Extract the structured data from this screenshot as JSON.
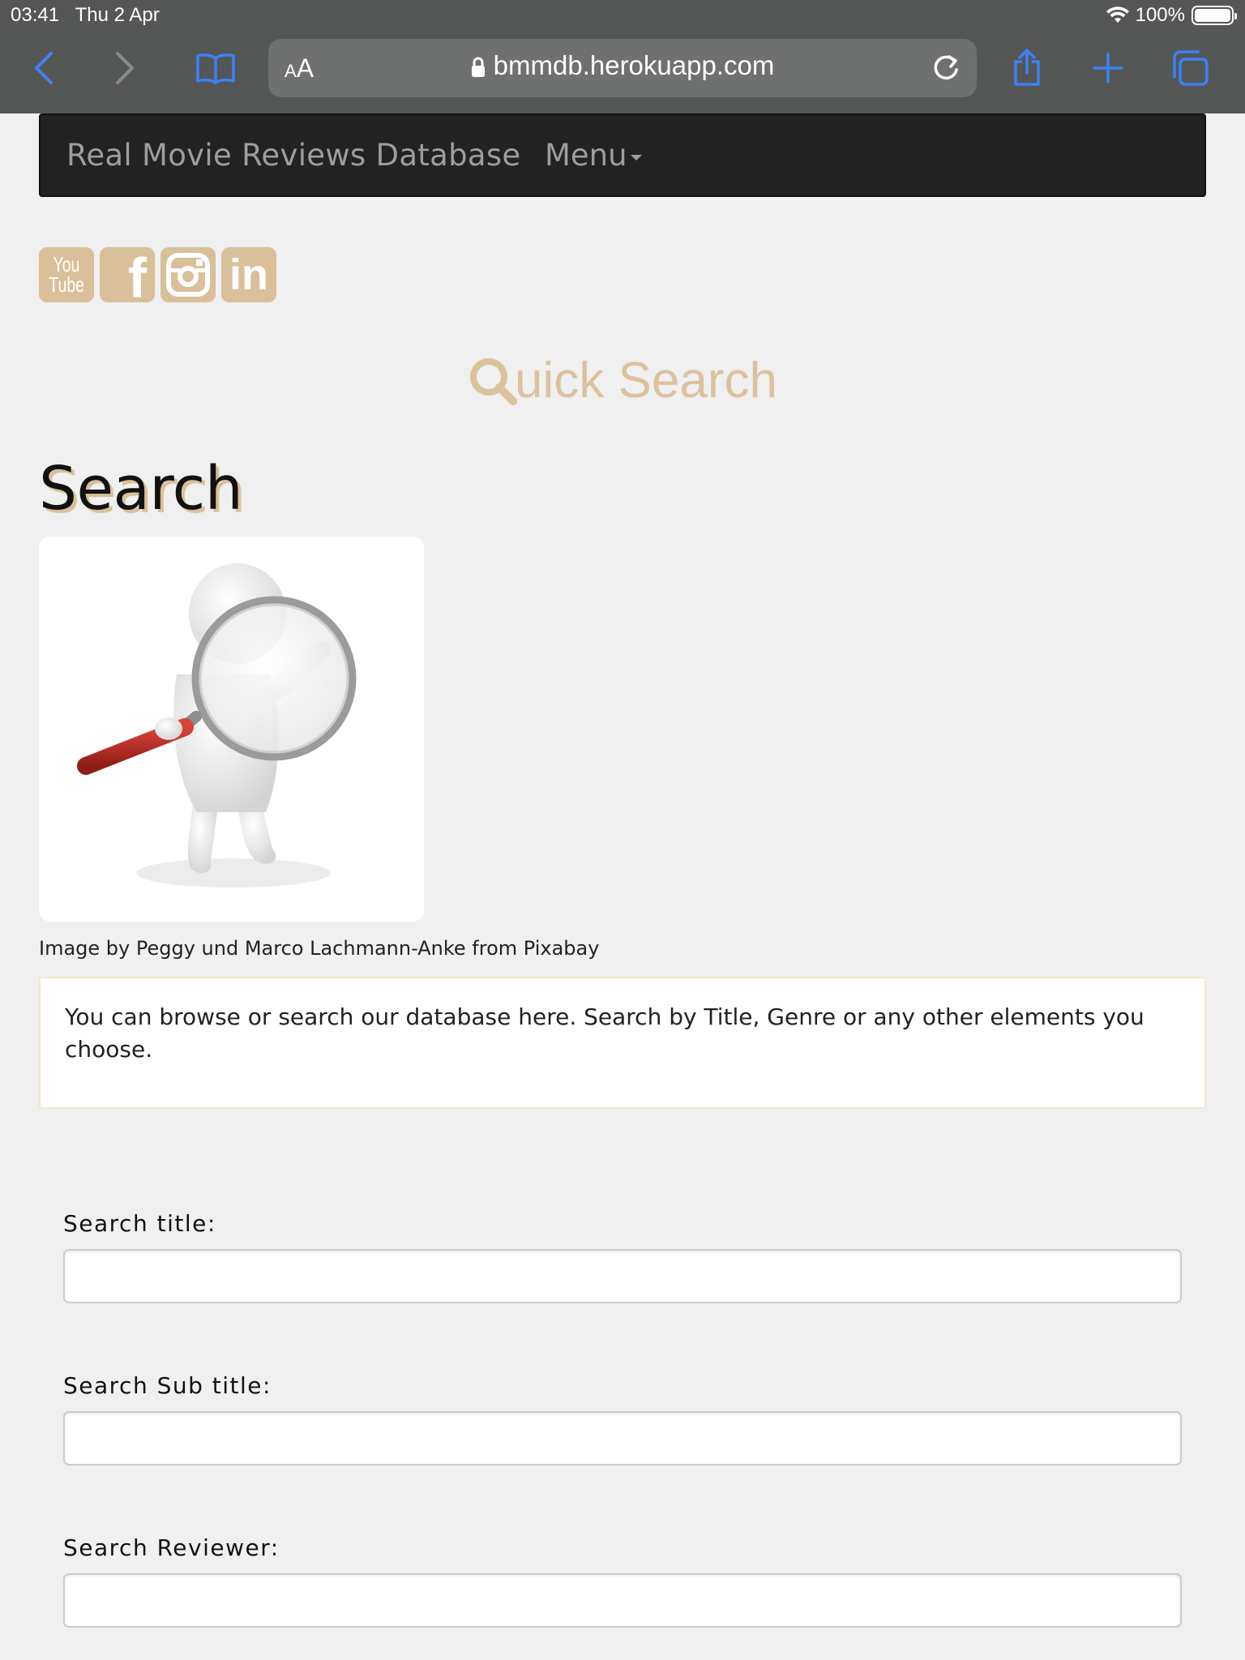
{
  "status_bar": {
    "time": "03:41",
    "date": "Thu 2 Apr",
    "battery_percent": "100%"
  },
  "browser": {
    "text_size_label_small": "A",
    "text_size_label_large": "A",
    "url": "bmmdb.herokuapp.com"
  },
  "navbar": {
    "brand": "Real Movie Reviews Database",
    "menu_label": "Menu"
  },
  "social": {
    "youtube_top": "You",
    "youtube_bottom": "Tube",
    "facebook_letter": "f",
    "linkedin_letters": "in"
  },
  "quick_search": {
    "label": "uick Search"
  },
  "page": {
    "title": "Search",
    "image_credit": "Image by Peggy und Marco Lachmann-Anke from Pixabay",
    "intro": "You can browse or search our database here. Search by Title, Genre or any other elements you choose."
  },
  "form": {
    "title_label": "Search title:",
    "subtitle_label": "Search Sub title:",
    "reviewer_label": "Search Reviewer:"
  },
  "colors": {
    "accent": "#d9c09a",
    "navbar_bg": "#222222",
    "page_bg": "#eff0ef",
    "browser_bar": "#555656"
  }
}
